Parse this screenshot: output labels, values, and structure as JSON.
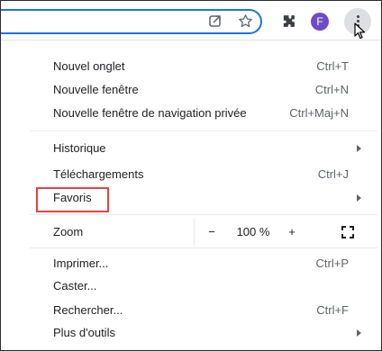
{
  "menu": {
    "items": [
      {
        "label": "Nouvel onglet",
        "shortcut": "Ctrl+T"
      },
      {
        "label": "Nouvelle fenêtre",
        "shortcut": "Ctrl+N"
      },
      {
        "label": "Nouvelle fenêtre de navigation privée",
        "shortcut": "Ctrl+Maj+N"
      },
      {
        "label": "Historique",
        "shortcut": ""
      },
      {
        "label": "Téléchargements",
        "shortcut": "Ctrl+J"
      },
      {
        "label": "Favoris",
        "shortcut": ""
      },
      {
        "label": "Imprimer...",
        "shortcut": "Ctrl+P"
      },
      {
        "label": "Caster...",
        "shortcut": ""
      },
      {
        "label": "Rechercher...",
        "shortcut": "Ctrl+F"
      },
      {
        "label": "Plus d'outils",
        "shortcut": ""
      }
    ],
    "zoom": {
      "label": "Zoom",
      "minus": "−",
      "value": "100 %",
      "plus": "+"
    }
  },
  "toolbar": {
    "avatar_letter": "F",
    "icons": [
      "share-icon",
      "star-icon",
      "extensions-icon",
      "avatar",
      "more-vert-icon"
    ]
  },
  "colors": {
    "avatar": "#6e4bc4",
    "highlight": "#e04444",
    "omnibox_focus": "#1a73e8"
  }
}
